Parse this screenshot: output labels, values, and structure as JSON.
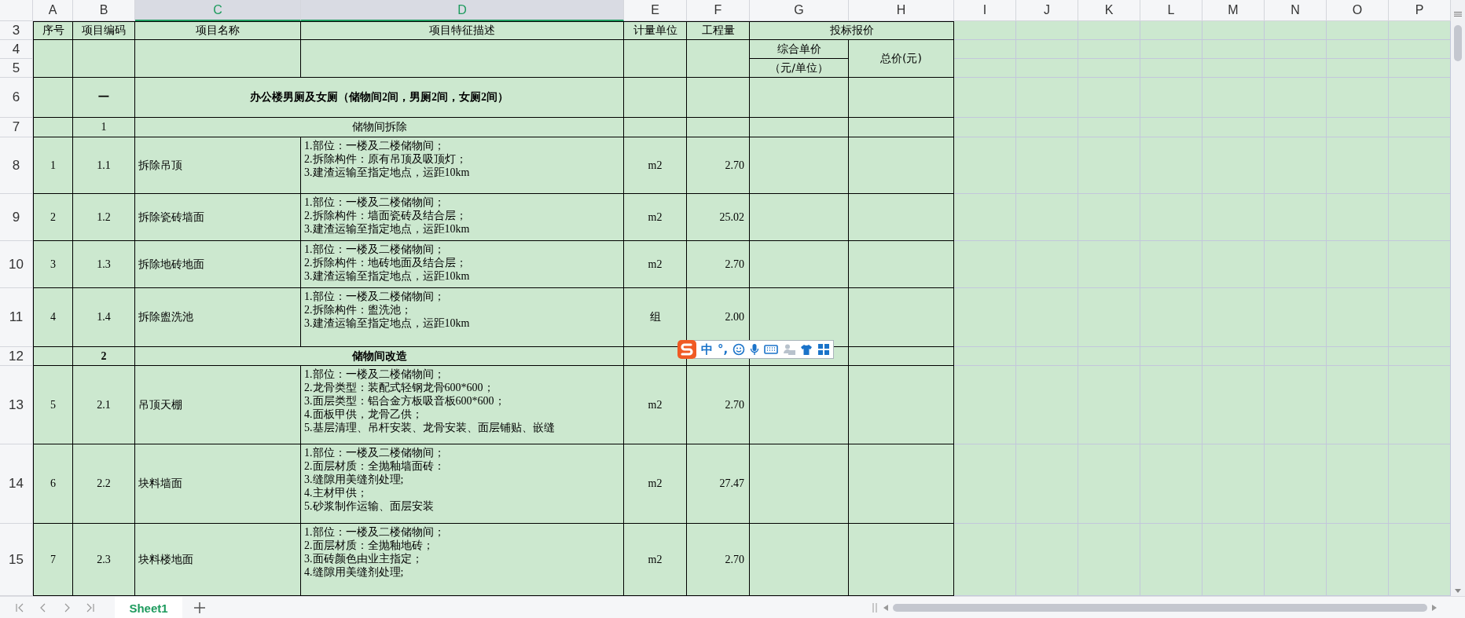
{
  "column_headers": [
    {
      "label": "A",
      "selected": false
    },
    {
      "label": "B",
      "selected": false
    },
    {
      "label": "C",
      "selected": true
    },
    {
      "label": "D",
      "selected": true
    },
    {
      "label": "E",
      "selected": false
    },
    {
      "label": "F",
      "selected": false
    },
    {
      "label": "G",
      "selected": false
    },
    {
      "label": "H",
      "selected": false
    },
    {
      "label": "I",
      "selected": false
    },
    {
      "label": "J",
      "selected": false
    },
    {
      "label": "K",
      "selected": false
    },
    {
      "label": "L",
      "selected": false
    },
    {
      "label": "M",
      "selected": false
    },
    {
      "label": "N",
      "selected": false
    },
    {
      "label": "O",
      "selected": false
    },
    {
      "label": "P",
      "selected": false
    }
  ],
  "row_numbers": [
    "3",
    "4",
    "5",
    "6",
    "7",
    "8",
    "9",
    "10",
    "11",
    "12",
    "13",
    "14",
    "15"
  ],
  "table_header": {
    "seq": "序号",
    "code": "项目编码",
    "name": "项目名称",
    "description": "项目特征描述",
    "unit": "计量单位",
    "quantity": "工程量",
    "bid": "投标报价",
    "unit_price": "综合单价",
    "unit_price_unit": "（元/单位）",
    "total": "总价(元)"
  },
  "rows": [
    {
      "kind": "title",
      "code": "一",
      "name": "办公楼男厕及女厕（储物间2间，男厕2间，女厕2间）"
    },
    {
      "kind": "section",
      "bold": false,
      "code": "1",
      "name": "储物间拆除"
    },
    {
      "kind": "item",
      "seq": "1",
      "code": "1.1",
      "name": "拆除吊顶",
      "description": [
        "1.部位：一楼及二楼储物间；",
        "2.拆除构件：原有吊顶及吸顶灯；",
        "3.建渣运输至指定地点，运距10km"
      ],
      "unit": "m2",
      "quantity": "2.70"
    },
    {
      "kind": "item",
      "seq": "2",
      "code": "1.2",
      "name": "拆除瓷砖墙面",
      "description": [
        "1.部位：一楼及二楼储物间；",
        "2.拆除构件：墙面瓷砖及结合层；",
        "3.建渣运输至指定地点，运距10km"
      ],
      "unit": "m2",
      "quantity": "25.02"
    },
    {
      "kind": "item",
      "seq": "3",
      "code": "1.3",
      "name": "拆除地砖地面",
      "description": [
        "1.部位：一楼及二楼储物间；",
        "2.拆除构件：地砖地面及结合层；",
        "3.建渣运输至指定地点，运距10km"
      ],
      "unit": "m2",
      "quantity": "2.70"
    },
    {
      "kind": "item",
      "seq": "4",
      "code": "1.4",
      "name": "拆除盥洗池",
      "description": [
        "1.部位：一楼及二楼储物间；",
        "2.拆除构件：盥洗池；",
        "3.建渣运输至指定地点，运距10km"
      ],
      "unit": "组",
      "quantity": "2.00"
    },
    {
      "kind": "section",
      "bold": true,
      "code": "2",
      "name": "储物间改造"
    },
    {
      "kind": "item",
      "seq": "5",
      "code": "2.1",
      "name": "吊顶天棚",
      "description": [
        "1.部位：一楼及二楼储物间；",
        "2.龙骨类型：装配式轻钢龙骨600*600；",
        "3.面层类型：铝合金方板吸音板600*600；",
        "4.面板甲供，龙骨乙供；",
        "5.基层清理、吊杆安装、龙骨安装、面层铺贴、嵌缝"
      ],
      "unit": "m2",
      "quantity": "2.70"
    },
    {
      "kind": "item",
      "seq": "6",
      "code": "2.2",
      "name": "块料墙面",
      "description": [
        "1.部位：一楼及二楼储物间；",
        "2.面层材质：全抛釉墙面砖：",
        "3.缝隙用美缝剂处理;",
        "4.主材甲供；",
        "5.砂浆制作运输、面层安装"
      ],
      "unit": "m2",
      "quantity": "27.47"
    },
    {
      "kind": "item",
      "seq": "7",
      "code": "2.3",
      "name": "块料楼地面",
      "description": [
        "1.部位：一楼及二楼储物间；",
        "2.面层材质：全抛釉地砖；",
        "3.面砖颜色由业主指定；",
        "4.缝隙用美缝剂处理;"
      ],
      "unit": "m2",
      "quantity": "2.70"
    }
  ],
  "ime_toolbar": {
    "mode": "中",
    "punctuation": "°,"
  },
  "sheet_tabs": [
    {
      "label": "Sheet1",
      "selected": true
    }
  ]
}
